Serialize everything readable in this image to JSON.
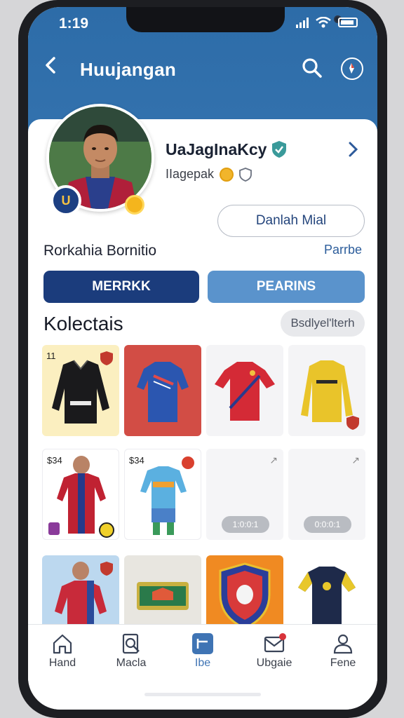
{
  "status": {
    "time": "1:19"
  },
  "topbar": {
    "title": "Huujangan",
    "back_icon": "chevron-left-icon",
    "search_icon": "search-icon",
    "compass_icon": "compass-icon"
  },
  "profile": {
    "username": "UaJagInaKcy",
    "subtitle": "IIagepak",
    "follow_label": "Danlah Mial",
    "section_name": "Rorkahia Bornitio",
    "section_link": "Parrbe",
    "badge_text": "U"
  },
  "tabs": [
    {
      "label": "MERRKK"
    },
    {
      "label": "PEARINS"
    }
  ],
  "collection": {
    "title": "Kolectais",
    "filter_label": "Bsdlyel'lterh",
    "items": [
      {
        "label": "11",
        "kind": "black-coat"
      },
      {
        "label": "",
        "kind": "blue-jersey"
      },
      {
        "label": "",
        "kind": "red-jersey"
      },
      {
        "label": "",
        "kind": "yellow-jersey"
      },
      {
        "label": "$34",
        "kind": "player-red"
      },
      {
        "label": "$34",
        "kind": "kit-blue"
      },
      {
        "label": "",
        "kind": "placeholder",
        "pill": "1:0:0:1"
      },
      {
        "label": "",
        "kind": "placeholder",
        "pill": "0:0:0:1"
      },
      {
        "label": "",
        "kind": "player-blue"
      },
      {
        "label": "",
        "kind": "scarf"
      },
      {
        "label": "",
        "kind": "crest"
      },
      {
        "label": "",
        "kind": "navy-jersey"
      }
    ]
  },
  "nav": [
    {
      "label": "Hand",
      "icon": "home-icon"
    },
    {
      "label": "Macla",
      "icon": "search-doc-icon"
    },
    {
      "label": "Ibe",
      "icon": "inbox-icon"
    },
    {
      "label": "Ubgaie",
      "icon": "mail-icon"
    },
    {
      "label": "Fene",
      "icon": "user-icon"
    }
  ],
  "colors": {
    "header": "#2d6ca8",
    "primary_tab": "#1b3c7c",
    "secondary_tab": "#5a93cc"
  }
}
